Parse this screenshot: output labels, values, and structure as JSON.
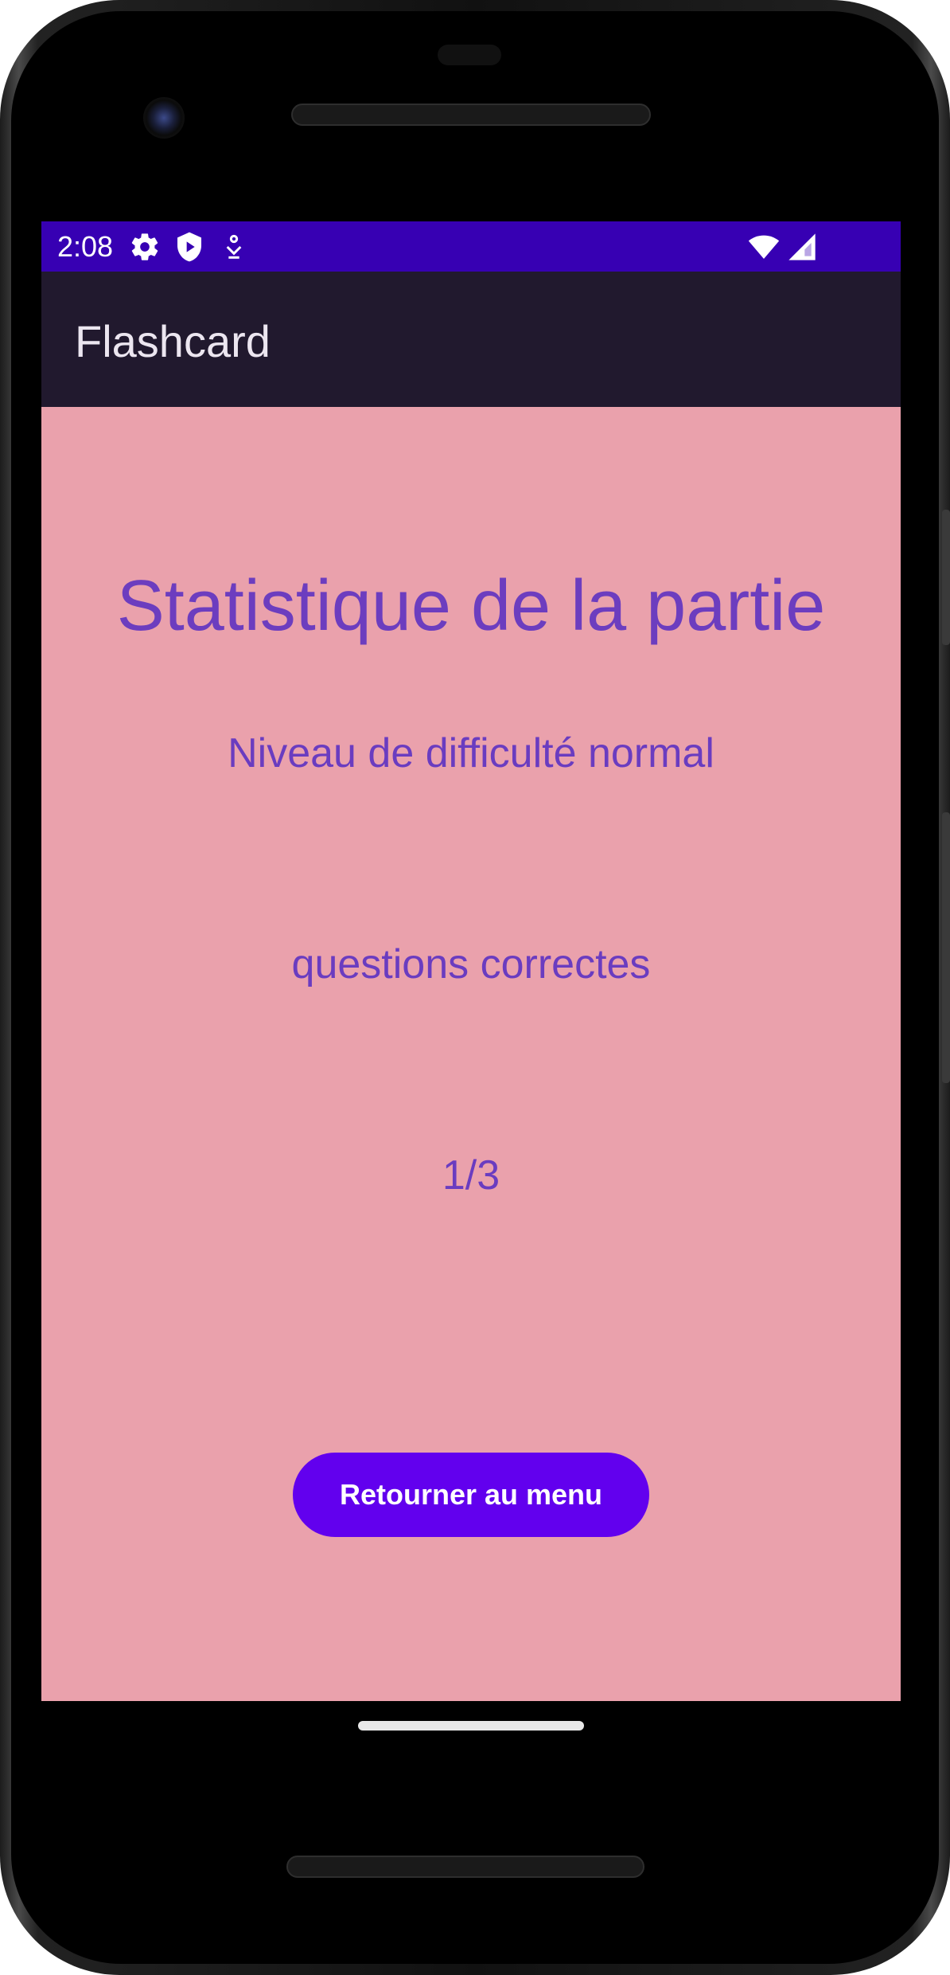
{
  "status_bar": {
    "time": "2:08",
    "background_color": "#3700b3",
    "left_icons": [
      "gear-icon",
      "shield-play-icon",
      "download-person-icon"
    ],
    "right_icons": [
      "wifi-icon",
      "cellular-signal-icon"
    ]
  },
  "app_bar": {
    "title": "Flashcard",
    "background_color": "#21192e"
  },
  "main": {
    "background_color": "#eaa1ac",
    "heading": "Statistique de la partie",
    "difficulty_text": "Niveau de difficulté normal",
    "correct_label": "questions correctes",
    "score": "1/3",
    "score_value": {
      "correct": 1,
      "total": 3
    },
    "text_color": "#6a3cc0"
  },
  "actions": {
    "back_to_menu_label": "Retourner au menu",
    "button_color": "#6200ee"
  }
}
